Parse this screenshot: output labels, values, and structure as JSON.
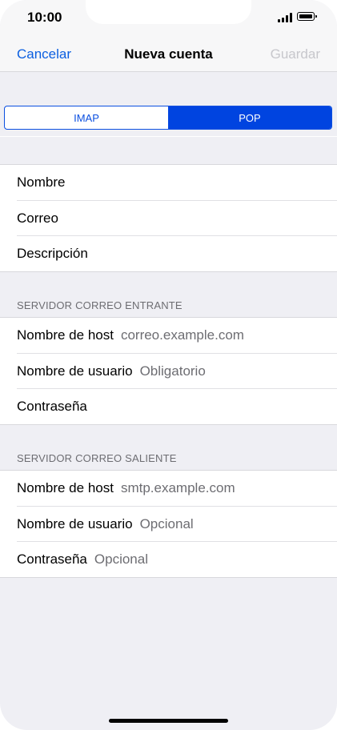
{
  "status": {
    "time": "10:00"
  },
  "nav": {
    "cancel": "Cancelar",
    "title": "Nueva cuenta",
    "save": "Guardar"
  },
  "segments": {
    "imap": "IMAP",
    "pop": "POP",
    "selected": "POP"
  },
  "account": {
    "name_label": "Nombre",
    "email_label": "Correo",
    "description_label": "Descripción"
  },
  "incoming": {
    "header": "SERVIDOR CORREO ENTRANTE",
    "host_label": "Nombre de host",
    "host_value": "correo.example.com",
    "user_label": "Nombre de usuario",
    "user_value": "Obligatorio",
    "password_label": "Contraseña"
  },
  "outgoing": {
    "header": "SERVIDOR CORREO SALIENTE",
    "host_label": "Nombre de host",
    "host_value": "smtp.example.com",
    "user_label": "Nombre de usuario",
    "user_value": "Opcional",
    "password_label": "Contraseña",
    "password_value": "Opcional"
  },
  "colors": {
    "accent": "#0b5fe0",
    "segment_active": "#0044e0",
    "background": "#efeff4"
  }
}
